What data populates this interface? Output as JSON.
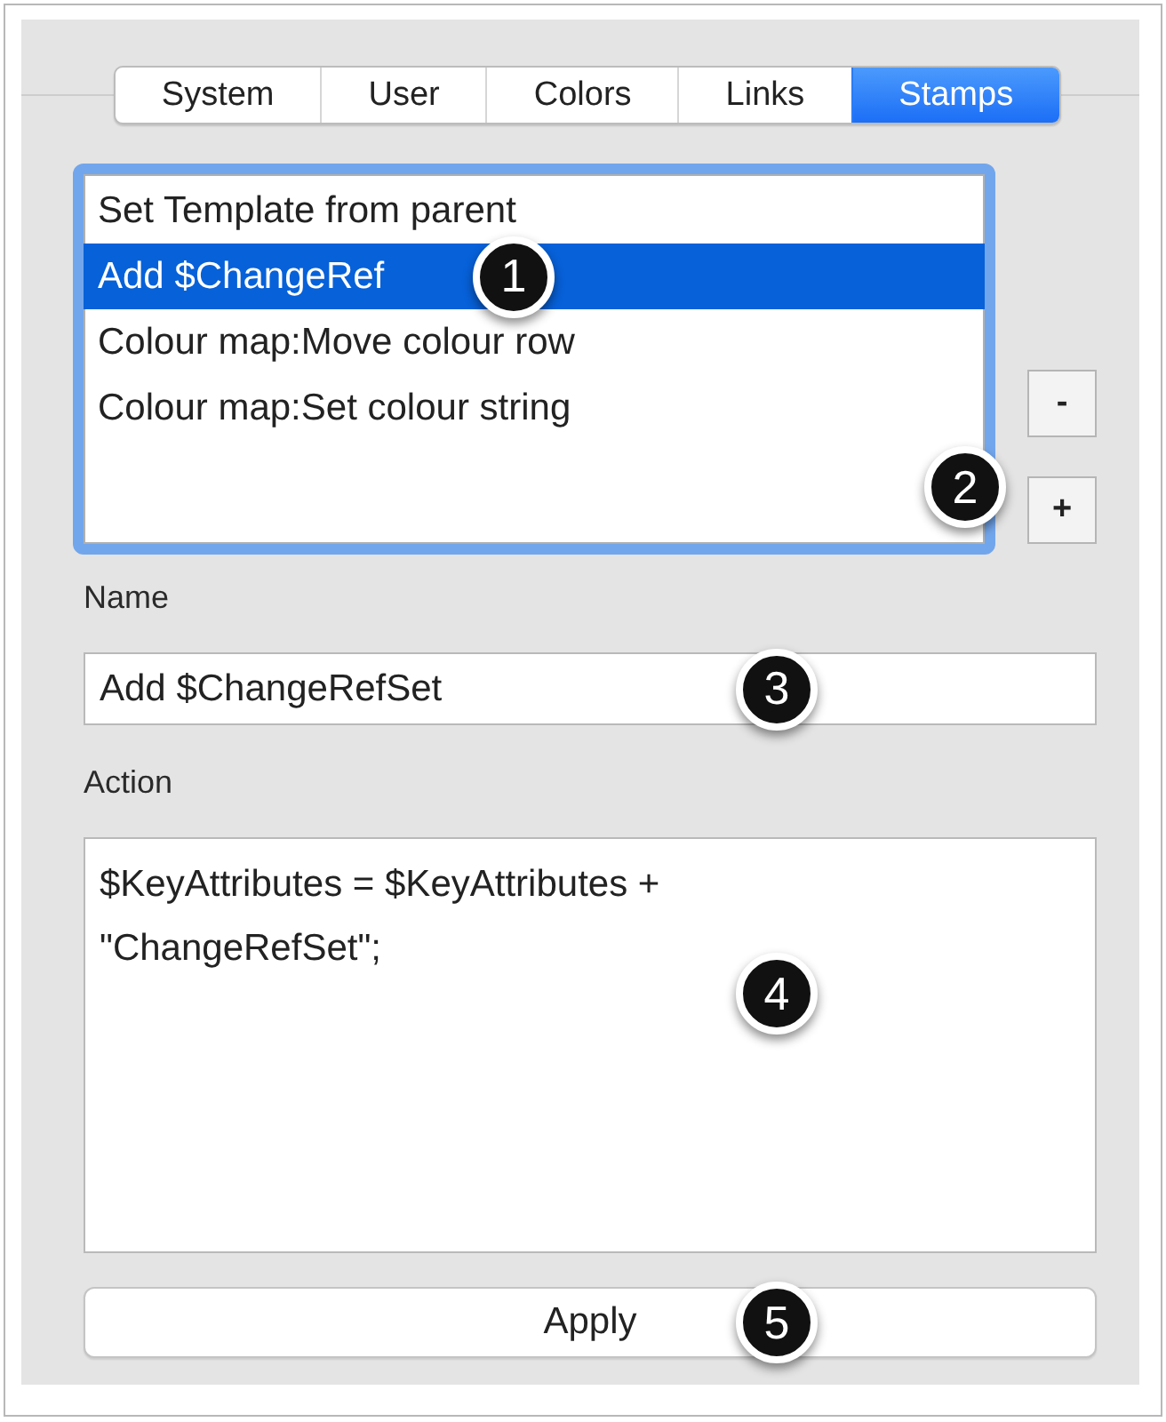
{
  "tabs": [
    {
      "label": "System",
      "selected": false
    },
    {
      "label": "User",
      "selected": false
    },
    {
      "label": "Colors",
      "selected": false
    },
    {
      "label": "Links",
      "selected": false
    },
    {
      "label": "Stamps",
      "selected": true
    }
  ],
  "stamps_list": {
    "focused": true,
    "items": [
      {
        "label": "Set Template from parent",
        "selected": false
      },
      {
        "label": "Add $ChangeRef",
        "selected": true,
        "callout": "1"
      },
      {
        "label": "Colour map:Move colour row",
        "selected": false
      },
      {
        "label": "Colour map:Set colour string",
        "selected": false
      }
    ]
  },
  "list_buttons": {
    "callout": "2",
    "buttons": [
      {
        "label": "-"
      },
      {
        "label": "+"
      }
    ]
  },
  "name_field": {
    "label": "Name",
    "value": "Add $ChangeRefSet",
    "callout": "3"
  },
  "action_field": {
    "label": "Action",
    "value": "$KeyAttributes = $KeyAttributes +\n\"ChangeRefSet\";",
    "callout": "4"
  },
  "apply_button": {
    "label": "Apply",
    "callout": "5"
  }
}
